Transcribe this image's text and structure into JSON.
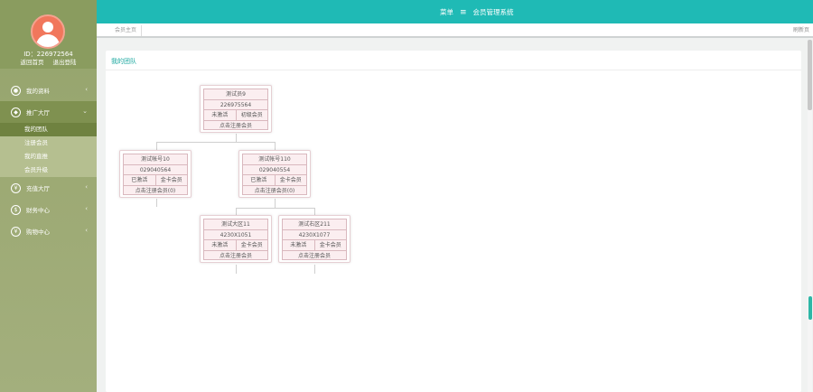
{
  "profile": {
    "id_text": "ID：226972564",
    "links": [
      "返回首页",
      "退出登陆"
    ]
  },
  "menu": {
    "items": [
      {
        "label": "我的资料",
        "icon": "user-icon"
      },
      {
        "label": "推广大厅",
        "icon": "share-icon"
      },
      {
        "label": "充值大厅",
        "icon": "recharge-icon"
      },
      {
        "label": "财务中心",
        "icon": "finance-icon"
      },
      {
        "label": "购物中心",
        "icon": "shop-icon"
      }
    ],
    "submenu": [
      "我的团队",
      "注册会员",
      "我的直推",
      "会员升级"
    ]
  },
  "header": {
    "menu_label": "菜单",
    "system_title": "会员管理系统"
  },
  "tabs": {
    "current": "会员主页",
    "right": "刷新页"
  },
  "panel": {
    "title": "我的团队"
  },
  "tree": [
    {
      "name": "测试员9",
      "id": "226975564",
      "status": "未激活",
      "level": "初级会员",
      "footer": "点击注册会员"
    },
    {
      "name": "测试帐号10",
      "id": "029040564",
      "status": "已激活",
      "level": "金卡会员",
      "footer": "点击注册会员(0)"
    },
    {
      "name": "测试帐号110",
      "id": "029040554",
      "status": "已激活",
      "level": "金卡会员",
      "footer": "点击注册会员(0)"
    },
    {
      "name": "测试大区11",
      "id": "4230X1051",
      "status": "未激活",
      "level": "金卡会员",
      "footer": "点击注册会员"
    },
    {
      "name": "测试右区211",
      "id": "4230X1077",
      "status": "未激活",
      "level": "金卡会员",
      "footer": "点击注册会员"
    }
  ],
  "colors": {
    "header": "#1fbab5",
    "sidebar": "#9ca973",
    "accent_text": "#1aa79f",
    "node_bg": "#fbeef0"
  }
}
